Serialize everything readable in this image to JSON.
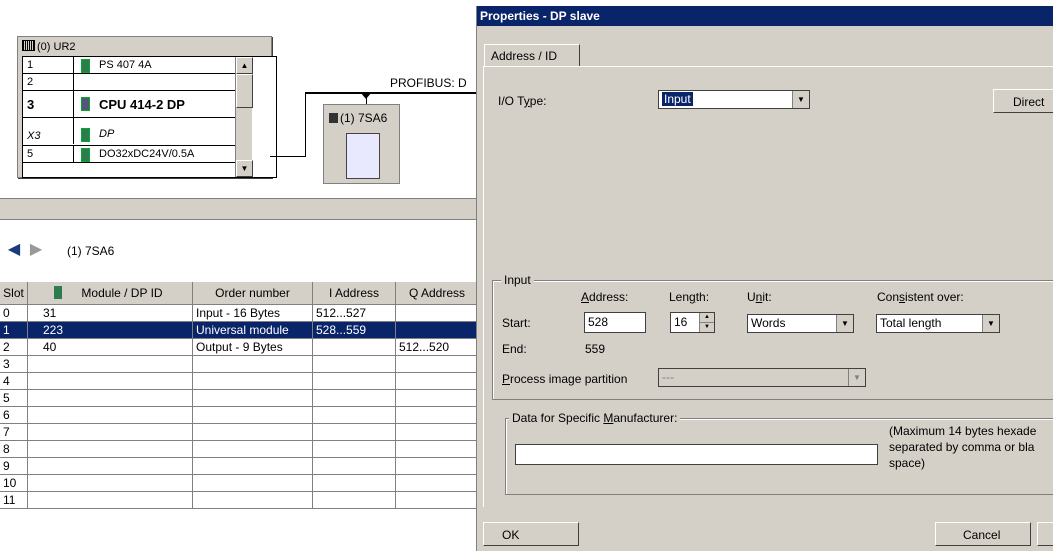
{
  "rack": {
    "title": "(0) UR2",
    "rows": [
      {
        "slot": "1",
        "module": "PS 407 4A"
      },
      {
        "slot": "2",
        "module": ""
      },
      {
        "slot": "3",
        "module": "CPU 414-2 DP"
      },
      {
        "slot": "X3",
        "module": "DP"
      },
      {
        "slot": "5",
        "module": "DO32xDC24V/0.5A"
      }
    ]
  },
  "profibus_label": "PROFIBUS: D",
  "slave_box_label": "(1) 7SA6",
  "nav": {
    "label": "(1)  7SA6"
  },
  "grid": {
    "headers": [
      "Slot",
      "Module / DP ID",
      "Order number",
      "I Address",
      "Q Address"
    ],
    "rows": [
      {
        "slot": "0",
        "id": "31",
        "order": "Input - 16 Bytes",
        "iaddr": "512...527",
        "qaddr": ""
      },
      {
        "slot": "1",
        "id": "223",
        "order": "Universal module",
        "iaddr": "528...559",
        "qaddr": ""
      },
      {
        "slot": "2",
        "id": "40",
        "order": "Output - 9 Bytes",
        "iaddr": "",
        "qaddr": "512...520"
      },
      {
        "slot": "3",
        "id": "",
        "order": "",
        "iaddr": "",
        "qaddr": ""
      },
      {
        "slot": "4",
        "id": "",
        "order": "",
        "iaddr": "",
        "qaddr": ""
      },
      {
        "slot": "5",
        "id": "",
        "order": "",
        "iaddr": "",
        "qaddr": ""
      },
      {
        "slot": "6",
        "id": "",
        "order": "",
        "iaddr": "",
        "qaddr": ""
      },
      {
        "slot": "7",
        "id": "",
        "order": "",
        "iaddr": "",
        "qaddr": ""
      },
      {
        "slot": "8",
        "id": "",
        "order": "",
        "iaddr": "",
        "qaddr": ""
      },
      {
        "slot": "9",
        "id": "",
        "order": "",
        "iaddr": "",
        "qaddr": ""
      },
      {
        "slot": "10",
        "id": "",
        "order": "",
        "iaddr": "",
        "qaddr": ""
      },
      {
        "slot": "11",
        "id": "",
        "order": "",
        "iaddr": "",
        "qaddr": ""
      }
    ]
  },
  "dialog": {
    "title": "Properties - DP slave",
    "tab": "Address / ID",
    "io_type_label": "I/O Type:",
    "io_type_value": "Input",
    "direct_button": "Direct",
    "input_group": "Input",
    "address_label": "Address:",
    "length_label": "Length:",
    "unit_label": "Unit:",
    "consistent_label": "Consistent over:",
    "start_label": "Start:",
    "start_value": "528",
    "length_value": "16",
    "unit_value": "Words",
    "consistent_value": "Total length",
    "end_label": "End:",
    "end_value": "559",
    "process_image_label": "Process image partition",
    "process_image_value": "---",
    "manufacturer_group": "Data for Specific Manufacturer:",
    "manufacturer_value": "",
    "hint_text_1": "(Maximum 14 bytes hexade",
    "hint_text_2": "separated by comma or bla",
    "hint_text_3": "space)",
    "ok_button": "OK",
    "cancel_button": "Cancel"
  },
  "colors": {
    "titlebar": "#0a246a",
    "selection": "#0a246a",
    "face": "#d4d0c8"
  }
}
